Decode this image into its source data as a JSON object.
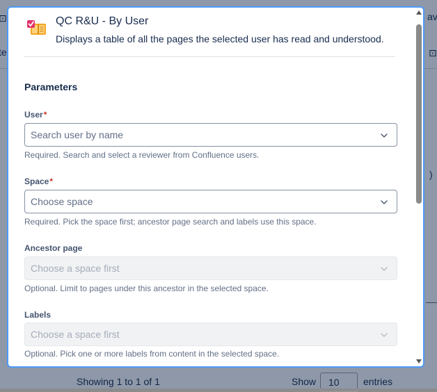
{
  "background": {
    "fragment_left_top": "⊡",
    "fragment_left_mid": "te",
    "fragment_right_top": "ave",
    "fragment_right_mid": "⊡",
    "fragment_right_low": ")",
    "footer": {
      "showing": "Showing 1 to 1 of 1",
      "show": "Show",
      "page_size": "10",
      "entries": "entries"
    }
  },
  "modal": {
    "title": "QC R&U - By User",
    "subtitle": "Displays a table of all the pages the selected user has read and understood.",
    "parameters_heading": "Parameters",
    "fields": [
      {
        "label": "User",
        "required_mark": "*",
        "placeholder": "Search user by name",
        "help": "Required. Search and select a reviewer from Confluence users."
      },
      {
        "label": "Space",
        "required_mark": "*",
        "placeholder": "Choose space",
        "help": "Required. Pick the space first; ancestor page search and labels use this space."
      },
      {
        "label": "Ancestor page",
        "placeholder": "Choose a space first",
        "help": "Optional. Limit to pages under this ancestor in the selected space."
      },
      {
        "label": "Labels",
        "placeholder": "Choose a space first",
        "help": "Optional. Pick one or more labels from content in the selected space."
      }
    ]
  },
  "icons": {
    "app": "checklist-book-icon",
    "dropdown": "chevron-down-icon"
  },
  "colors": {
    "focus_border": "#4c9aff",
    "required": "#c9372c",
    "text": "#172b4d",
    "help_text": "#626f86"
  }
}
